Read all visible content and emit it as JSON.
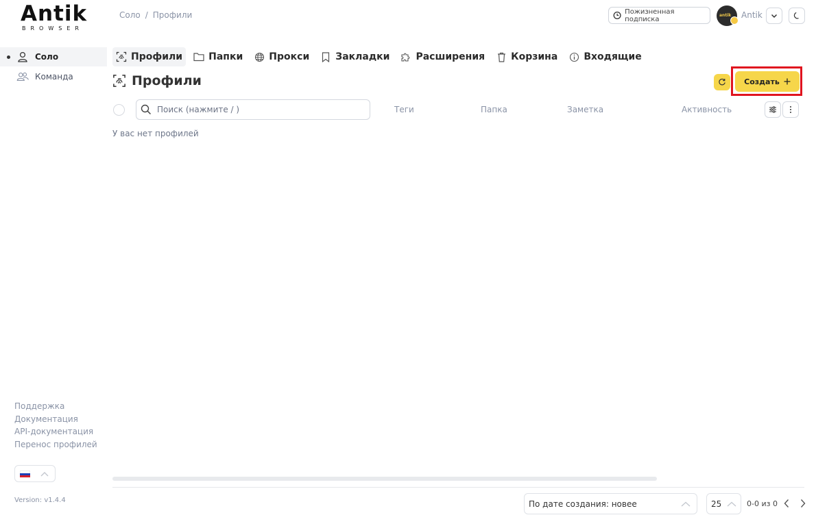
{
  "logo": {
    "main": "Antik",
    "sub": "BROWSER"
  },
  "breadcrumb": {
    "root": "Соло",
    "separator": "/",
    "current": "Профили"
  },
  "header": {
    "subscription_label": "Пожизненная подписка",
    "avatar_text": "antik",
    "user_name": "Antik",
    "theme_icon": "moon-icon"
  },
  "sidebar": {
    "items": [
      {
        "label": "Соло",
        "icon": "user-icon",
        "active": true
      },
      {
        "label": "Команда",
        "icon": "users-icon",
        "active": false
      }
    ],
    "links": [
      "Поддержка",
      "Документация",
      "API-документация",
      "Перенос профилей"
    ],
    "language_flag": "RU",
    "version": "Version: v1.4.4"
  },
  "tabs": [
    {
      "label": "Профили",
      "icon": "fingerprint-icon",
      "active": true
    },
    {
      "label": "Папки",
      "icon": "folder-icon"
    },
    {
      "label": "Прокси",
      "icon": "globe-icon"
    },
    {
      "label": "Закладки",
      "icon": "bookmark-icon"
    },
    {
      "label": "Расширения",
      "icon": "puzzle-icon"
    },
    {
      "label": "Корзина",
      "icon": "trash-icon"
    },
    {
      "label": "Входящие",
      "icon": "info-icon"
    }
  ],
  "main": {
    "title": "Профили",
    "create_label": "Создать",
    "search_placeholder": "Поиск (нажмите / )",
    "columns": [
      "Теги",
      "Папка",
      "Заметка",
      "Активность"
    ],
    "empty_text": "У вас нет профилей"
  },
  "footer": {
    "sort_value": "По дате создания: новее",
    "per_page": "25",
    "range": "0-0 из 0"
  },
  "colors": {
    "accent": "#f6d64a",
    "highlight_frame": "#e0141e",
    "muted_text": "#8a93a6"
  }
}
